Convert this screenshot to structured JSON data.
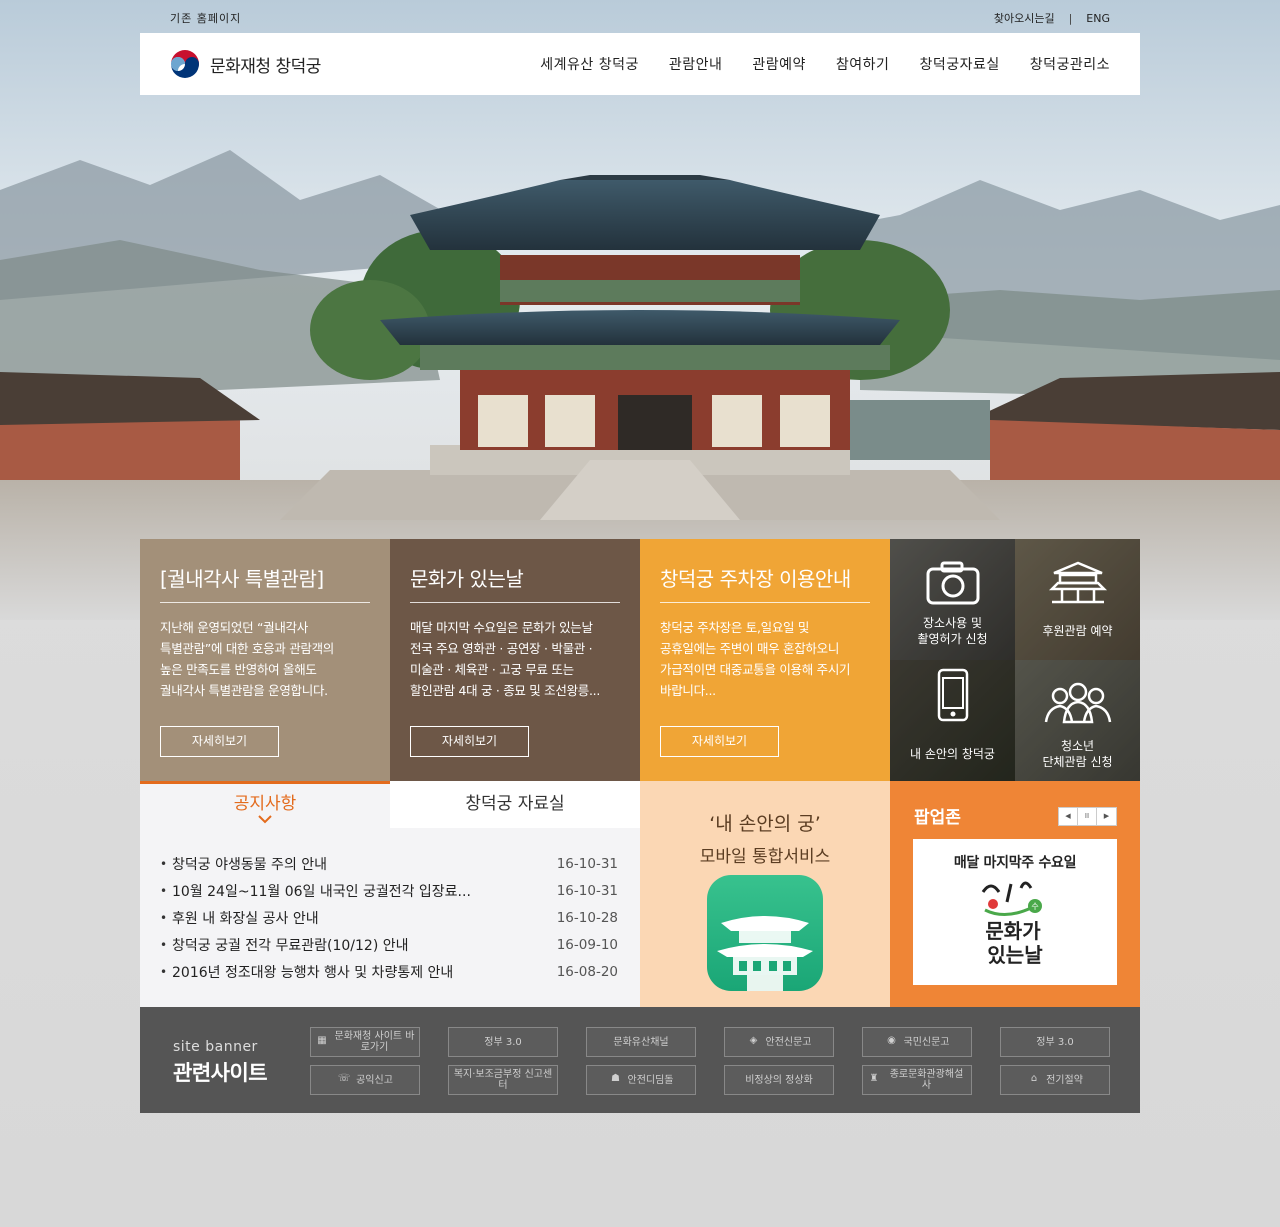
{
  "utility": {
    "old_homepage": "기존 홈페이지",
    "directions": "찾아오시는길",
    "separator": "|",
    "english": "ENG"
  },
  "header": {
    "logo_text": "문화재청 창덕궁",
    "nav": [
      "세계유산 창덕궁",
      "관람안내",
      "관람예약",
      "참여하기",
      "창덕궁자료실",
      "창덕궁관리소"
    ]
  },
  "features": [
    {
      "title": "[궐내각사 특별관람]",
      "lines": [
        "지난해 운영되었던 “궐내각사",
        "특별관람”에 대한 호응과 관람객의",
        "높은 만족도를 반영하여 올해도",
        "궐내각사 특별관람을 운영합니다."
      ],
      "button": "자세히보기",
      "color": "#a39079"
    },
    {
      "title": "문화가 있는날",
      "lines": [
        "매달 마지막 수요일은 문화가 있는날",
        "전국 주요 영화관 · 공연장 · 박물관 ·",
        "미술관 · 체육관 · 고궁 무료 또는",
        "할인관람 4대 궁 · 종묘 및 조선왕릉..."
      ],
      "button": "자세히보기",
      "color": "#6d5747"
    },
    {
      "title": "창덕궁 주차장 이용안내",
      "lines": [
        "창덕궁 주차장은 토,일요일 및",
        "공휴일에는 주변이 매우 혼잡하오니",
        "가급적이면 대중교통을 이용해 주시기",
        "바랍니다..."
      ],
      "button": "자세히보기",
      "color": "#f0a536"
    }
  ],
  "quick_links": [
    {
      "label_1": "장소사용 및",
      "label_2": "촬영허가 신청",
      "icon": "camera-icon"
    },
    {
      "label_1": "후원관람 예약",
      "label_2": "",
      "icon": "palace-icon"
    },
    {
      "label_1": "내 손안의 창덕궁",
      "label_2": "",
      "icon": "mobile-icon"
    },
    {
      "label_1": "청소년",
      "label_2": "단체관람 신청",
      "icon": "group-icon"
    }
  ],
  "board": {
    "tabs": [
      "공지사항",
      "창덕궁 자료실"
    ],
    "notices": [
      {
        "title": "창덕궁 야생동물 주의 안내",
        "date": "16-10-31"
      },
      {
        "title": "10월 24일~11월 06일 내국인 궁궐전각 입장료...",
        "date": "16-10-31"
      },
      {
        "title": "후원 내 화장실 공사 안내",
        "date": "16-10-28"
      },
      {
        "title": "창덕궁 궁궐 전각 무료관람(10/12) 안내",
        "date": "16-09-10"
      },
      {
        "title": "2016년 정조대왕 능행차 행사 및 차량통제 안내",
        "date": "16-08-20"
      }
    ]
  },
  "mobile": {
    "title": "‘내 손안의 궁’",
    "subtitle": "모바일 통합서비스"
  },
  "popup": {
    "title": "팝업존",
    "controls": [
      "◀",
      "II",
      "▶"
    ],
    "card_title": "매달 마지막주 수요일",
    "card_logo_line1": "문화가",
    "card_logo_line2": "있는날",
    "card_logo_mark": "수"
  },
  "site_banner": {
    "label_en": "site banner",
    "label_ko": "관련사이트",
    "items": [
      "문화재청 사이트 바로가기",
      "정부 3.0",
      "문화유산채널",
      "안전신문고",
      "국민신문고",
      "정부 3.0",
      "공익신고",
      "복지·보조금부정 신고센터",
      "안전디딤돌",
      "비정상의 정상화",
      "종로문화관광해설사",
      "전기절약"
    ]
  }
}
